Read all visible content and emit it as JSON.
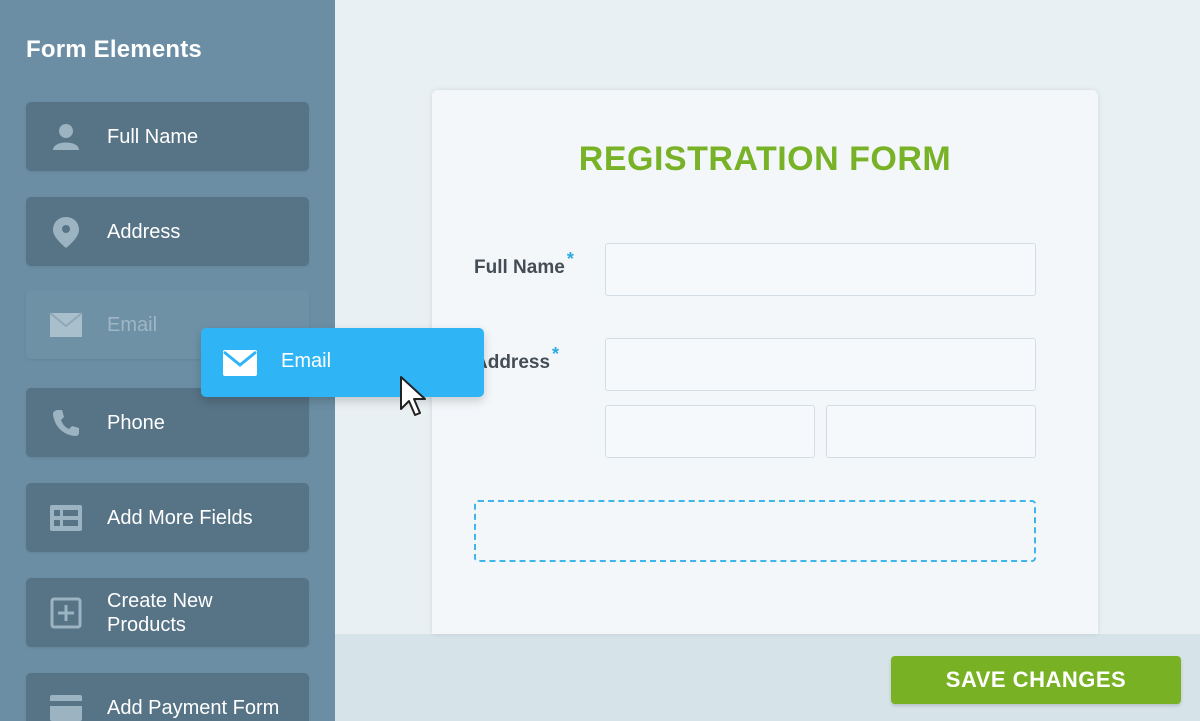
{
  "sidebar": {
    "title": "Form Elements",
    "items": [
      {
        "label": "Full Name",
        "icon": "user-icon"
      },
      {
        "label": "Address",
        "icon": "location-pin-icon"
      },
      {
        "label": "Email",
        "icon": "envelope-icon",
        "state": "being-dragged"
      },
      {
        "label": "Phone",
        "icon": "phone-icon"
      },
      {
        "label": "Add More Fields",
        "icon": "fields-list-icon"
      },
      {
        "label": "Create New\nProducts",
        "icon": "plus-square-icon"
      },
      {
        "label": "Add Payment Form",
        "icon": "credit-card-icon"
      }
    ]
  },
  "drag": {
    "label": "Email",
    "icon": "envelope-icon"
  },
  "form": {
    "title": "REGISTRATION FORM",
    "fields": [
      {
        "label": "Full Name",
        "required_mark": "*"
      },
      {
        "label": "Address",
        "required_mark": "*"
      }
    ]
  },
  "actions": {
    "save_label": "SAVE CHANGES"
  },
  "colors": {
    "sidebar_bg": "#6b8ea4",
    "sidebar_item_bg": "#577386",
    "accent_green": "#78b226",
    "drag_blue": "#2fb5f6",
    "required_blue": "#29a9e0"
  }
}
